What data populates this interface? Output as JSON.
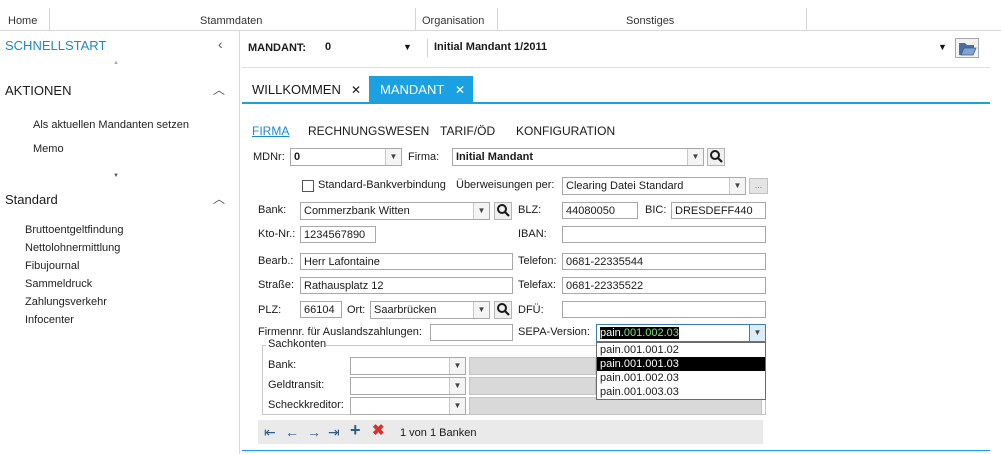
{
  "menu": {
    "home": "Home",
    "stammdaten": "Stammdaten",
    "organisation": "Organisation",
    "sonstiges": "Sonstiges"
  },
  "left": {
    "schnellstart": "SCHNELLSTART",
    "aktionen": "AKTIONEN",
    "aktionen_items": [
      "Als aktuellen Mandanten setzen",
      "Memo"
    ],
    "standard": "Standard",
    "standard_items": [
      "Bruttoentgeltfindung",
      "Nettolohnermittlung",
      "Fibujournal",
      "Sammeldruck",
      "Zahlungsverkehr",
      "Infocenter"
    ]
  },
  "toolbar": {
    "mandant_label": "MANDANT:",
    "mandant_nr": "0",
    "mandant_name": "Initial Mandant 1/2011"
  },
  "tabs": [
    {
      "label": "WILLKOMMEN",
      "close": "✕",
      "active": false
    },
    {
      "label": "MANDANT",
      "close": "✕",
      "active": true
    }
  ],
  "subtabs": [
    "FIRMA",
    "RECHNUNGSWESEN",
    "TARIF/ÖD",
    "KONFIGURATION"
  ],
  "form": {
    "mdnr_label": "MDNr:",
    "mdnr_value": "0",
    "firma_label": "Firma:",
    "firma_value": "Initial Mandant",
    "std_bank_label": "Standard-Bankverbindung",
    "ueberweisung_label": "Überweisungen per:",
    "ueberweisung_value": "Clearing Datei Standard",
    "more_button": "...",
    "bank_label": "Bank:",
    "bank_value": "Commerzbank Witten",
    "blz_label": "BLZ:",
    "blz_value": "44080050",
    "bic_label": "BIC:",
    "bic_value": "DRESDEFF440",
    "kto_label": "Kto-Nr.:",
    "kto_value": "1234567890",
    "iban_label": "IBAN:",
    "iban_value": "",
    "bearb_label": "Bearb.:",
    "bearb_value": "Herr Lafontaine",
    "telefon_label": "Telefon:",
    "telefon_value": "0681-22335544",
    "strasse_label": "Straße:",
    "strasse_value": "Rathausplatz 12",
    "telefax_label": "Telefax:",
    "telefax_value": "0681-22335522",
    "plz_label": "PLZ:",
    "plz_value": "66104",
    "ort_label": "Ort:",
    "ort_value": "Saarbrücken",
    "dfue_label": "DFÜ:",
    "dfue_value": "",
    "firmennr_label": "Firmennr. für Auslandszahlungen:",
    "firmennr_value": "",
    "sepa_label": "SEPA-Version:",
    "sepa_value_prefix": "pain.",
    "sepa_value_rest": "001.002.03",
    "sepa_options": [
      "pain.001.001.02",
      "pain.001.001.03",
      "pain.001.002.03",
      "pain.001.003.03"
    ],
    "sepa_highlighted": 1
  },
  "sachkonten": {
    "title": "Sachkonten",
    "bank_label": "Bank:",
    "geldtransit_label": "Geldtransit:",
    "scheckkreditor_label": "Scheckkreditor:"
  },
  "navigation": {
    "record_text": "1 von 1 Banken"
  },
  "colors": {
    "accent": "#1ba1e2",
    "link_blue": "#1e88c9",
    "delete_red": "#d93030"
  }
}
